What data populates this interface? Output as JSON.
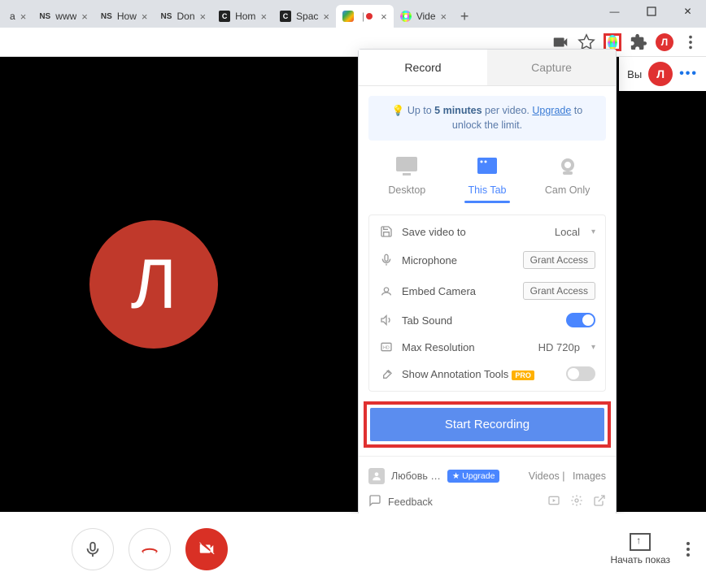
{
  "window_controls": {
    "minimize": "—",
    "maximize": "▢",
    "close": "✕"
  },
  "tabs": [
    {
      "favicon": "generic",
      "title": "a",
      "active": false
    },
    {
      "favicon": "ns",
      "title": "www",
      "active": false
    },
    {
      "favicon": "ns",
      "title": "How",
      "active": false
    },
    {
      "favicon": "ns",
      "title": "Don",
      "active": false
    },
    {
      "favicon": "ci",
      "title": "Hom",
      "active": false
    },
    {
      "favicon": "ci",
      "title": "Spac",
      "active": false
    },
    {
      "favicon": "meet",
      "title": "",
      "active": true
    },
    {
      "favicon": "ring",
      "title": "Vide",
      "active": false
    }
  ],
  "toolbar": {
    "avatar_letter": "Л"
  },
  "meet_header": {
    "label": "Вы",
    "avatar_letter": "Л"
  },
  "big_avatar_letter": "Л",
  "bottombar": {
    "present_label": "Начать показ"
  },
  "popup": {
    "tabs": {
      "record": "Record",
      "capture": "Capture"
    },
    "promo": {
      "prefix": "Up to ",
      "bold": "5 minutes",
      "mid": " per video. ",
      "link": "Upgrade",
      "suffix": " to unlock the limit."
    },
    "modes": {
      "desktop": "Desktop",
      "this_tab": "This Tab",
      "cam_only": "Cam Only"
    },
    "settings": {
      "save_video": {
        "label": "Save video to",
        "value": "Local"
      },
      "microphone": {
        "label": "Microphone",
        "action": "Grant Access"
      },
      "embed_camera": {
        "label": "Embed Camera",
        "action": "Grant Access"
      },
      "tab_sound": {
        "label": "Tab Sound",
        "on": true
      },
      "max_resolution": {
        "label": "Max Resolution",
        "value": "HD 720p"
      },
      "annotation": {
        "label": "Show Annotation Tools",
        "badge": "PRO",
        "on": false
      }
    },
    "start_button": "Start Recording",
    "footer": {
      "user": "Любовь …",
      "upgrade_badge": "★ Upgrade",
      "videos": "Videos",
      "images": "Images",
      "feedback": "Feedback"
    }
  }
}
